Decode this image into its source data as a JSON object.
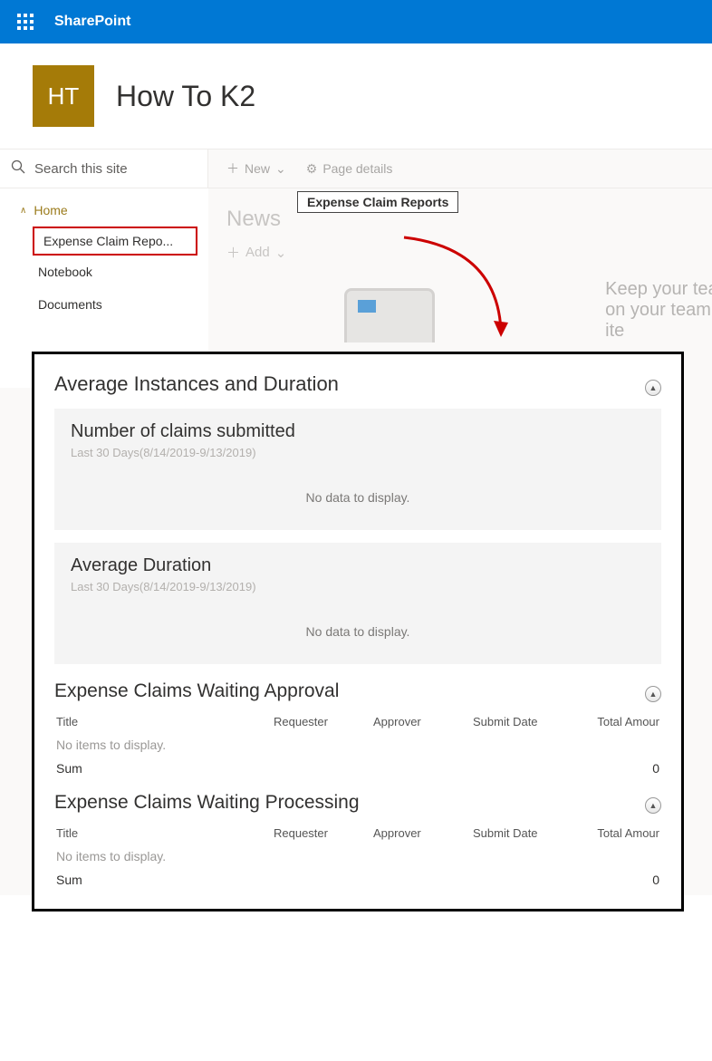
{
  "suite": {
    "product": "SharePoint"
  },
  "site": {
    "logo_initials": "HT",
    "title": "How To K2"
  },
  "search": {
    "placeholder": "Search this site"
  },
  "commands": {
    "new": "New",
    "page_details": "Page details"
  },
  "nav": {
    "home": "Home",
    "items": [
      {
        "label": "Expense Claim Repo..."
      },
      {
        "label": "Notebook"
      },
      {
        "label": "Documents"
      }
    ],
    "tooltip": "Expense Claim Reports"
  },
  "news": {
    "title": "News",
    "add": "Add"
  },
  "hint": "Keep your team u\non your team site\nite",
  "panel": {
    "section1": {
      "title": "Average Instances and Duration",
      "card1": {
        "title": "Number of claims submitted",
        "sub": "Last 30 Days(8/14/2019-9/13/2019)",
        "empty": "No data to display."
      },
      "card2": {
        "title": "Average Duration",
        "sub": "Last 30 Days(8/14/2019-9/13/2019)",
        "empty": "No data to display."
      }
    },
    "section2": {
      "title": "Expense Claims  Waiting Approval",
      "cols": {
        "title": "Title",
        "requester": "Requester",
        "approver": "Approver",
        "date": "Submit Date",
        "amount": "Total Amour"
      },
      "empty": "No items to display.",
      "sum_label": "Sum",
      "sum_value": "0"
    },
    "section3": {
      "title": "Expense Claims Waiting Processing",
      "cols": {
        "title": "Title",
        "requester": "Requester",
        "approver": "Approver",
        "date": "Submit Date",
        "amount": "Total Amour"
      },
      "empty": "No items to display.",
      "sum_label": "Sum",
      "sum_value": "0"
    }
  }
}
